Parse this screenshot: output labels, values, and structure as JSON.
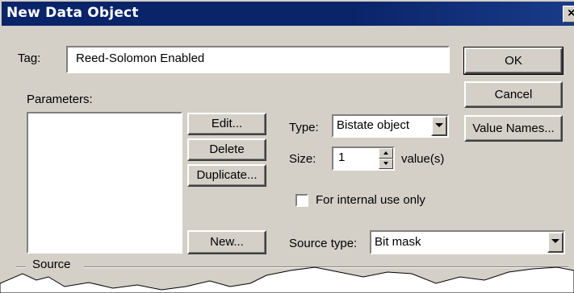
{
  "window": {
    "title": "New Data Object",
    "close_glyph": "×"
  },
  "tag": {
    "label": "Tag:",
    "value": "Reed-Solomon Enabled"
  },
  "parameters": {
    "label": "Parameters:"
  },
  "buttons": {
    "ok": "OK",
    "cancel": "Cancel",
    "value_names": "Value Names...",
    "edit": "Edit...",
    "delete": "Delete",
    "duplicate": "Duplicate...",
    "new": "New..."
  },
  "type": {
    "label": "Type:",
    "value": "Bistate object"
  },
  "size": {
    "label": "Size:",
    "value": "1",
    "unit": "value(s)"
  },
  "internal_only": {
    "label": "For internal use only",
    "checked": false
  },
  "source_type": {
    "label": "Source type:",
    "value": "Bit mask"
  },
  "source_group": {
    "label": "Source"
  },
  "colors": {
    "face": "#d4d0c8",
    "title_bar": "#0a246a",
    "field": "#ffffff"
  }
}
